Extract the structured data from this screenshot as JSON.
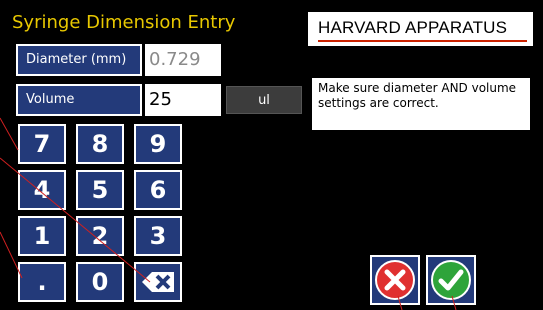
{
  "header": {
    "title": "Syringe Dimension Entry",
    "brand": "HARVARD APPARATUS"
  },
  "fields": {
    "diameter_label": "Diameter (mm)",
    "diameter_value": "0.729",
    "volume_label": "Volume",
    "volume_value": "25",
    "volume_unit": "ul"
  },
  "note": {
    "text": "Make sure diameter AND volume settings are correct."
  },
  "keypad": {
    "keys": [
      "7",
      "8",
      "9",
      "4",
      "5",
      "6",
      "1",
      "2",
      "3",
      ".",
      "0"
    ]
  },
  "actions": {
    "cancel_icon": "red-x-icon",
    "confirm_icon": "green-check-icon"
  },
  "colors": {
    "title": "#e8c800",
    "button_bg": "#233a7a",
    "cancel": "#e03030",
    "confirm": "#2ea43a"
  }
}
